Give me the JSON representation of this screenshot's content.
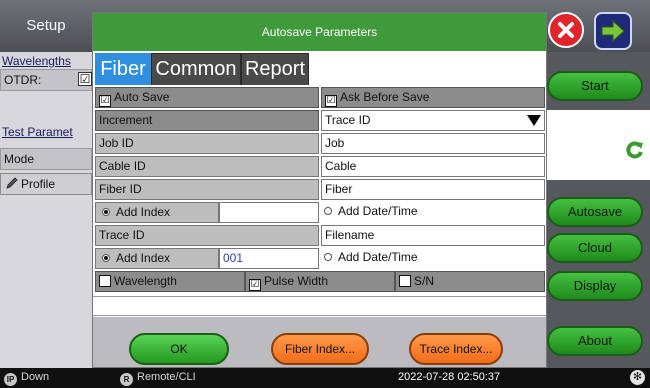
{
  "background": {
    "left_title": "Setup",
    "left_items": {
      "wavelengths": "Wavelengths",
      "otdr": "OTDR:",
      "otdr_checked": "☑",
      "test_params": "Test Paramet",
      "mode": "Mode",
      "profile": "Profile"
    },
    "right_buttons": {
      "start": "Start",
      "autosave": "Autosave",
      "cloud": "Cloud",
      "display": "Display",
      "about": "About"
    }
  },
  "dialog": {
    "title": "Autosave Parameters",
    "tabs": [
      "Fiber",
      "Common",
      "Report"
    ],
    "active_tab": "Fiber",
    "auto_save": "Auto Save",
    "ask_before_save": "Ask Before Save",
    "increment_label": "Increment",
    "increment_value": "Trace ID",
    "job_id_label": "Job ID",
    "job_id_value": "Job",
    "cable_id_label": "Cable ID",
    "cable_id_value": "Cable",
    "fiber_id_label": "Fiber ID",
    "fiber_id_value": "Fiber",
    "fiber_add_index": "Add Index",
    "fiber_add_index_value": "",
    "fiber_add_datetime": "Add Date/Time",
    "trace_id_label": "Trace ID",
    "trace_id_value": "Filename",
    "trace_add_index": "Add Index",
    "trace_add_index_value": "001",
    "trace_add_datetime": "Add Date/Time",
    "wavelength": "Wavelength",
    "pulse_width": "Pulse Width",
    "sn": "S/N",
    "checkmark": "☑",
    "buttons": {
      "ok": "OK",
      "fiber_index": "Fiber Index...",
      "trace_index": "Trace Index..."
    }
  },
  "status": {
    "left_icon": "IP",
    "left_text": "Down",
    "mid_icon": "R",
    "mid_text": "Remote/CLI",
    "datetime": "2022-07-28  02:50:37",
    "right_icon": "✻"
  },
  "colors": {
    "title_green": "#3f9a3b",
    "tab_blue": "#2f8fde",
    "ok_green": "#239a1f",
    "orange": "#f26c1a",
    "close_red": "#e0242a",
    "nav_blue": "#1f2b78"
  }
}
